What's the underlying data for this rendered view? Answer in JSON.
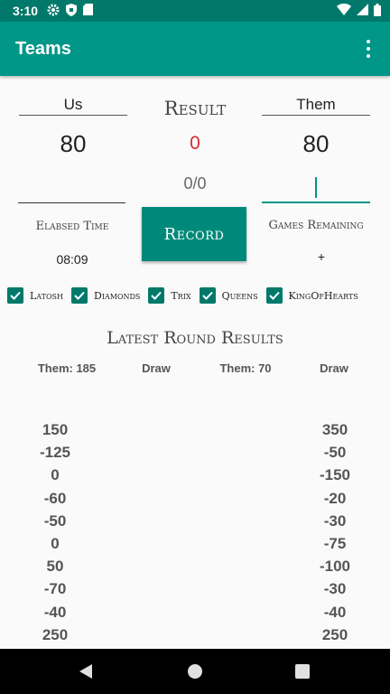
{
  "status_bar": {
    "time": "3:10"
  },
  "app_bar": {
    "title": "Teams"
  },
  "teams": {
    "us": {
      "label": "Us",
      "score": "80"
    },
    "them": {
      "label": "Them",
      "score": "80"
    }
  },
  "result": {
    "title": "Result",
    "value": "0",
    "ratio": "0/0"
  },
  "elapsed": {
    "label": "Elabsed Time",
    "value": "08:09"
  },
  "games_remaining": {
    "label": "Games Remaining",
    "value": "+"
  },
  "record_button": {
    "label": "Record"
  },
  "games": [
    {
      "label": "Latosh",
      "checked": true
    },
    {
      "label": "Diamonds",
      "checked": true
    },
    {
      "label": "Trix",
      "checked": true
    },
    {
      "label": "Queens",
      "checked": true
    },
    {
      "label": "KingOfHearts",
      "checked": true
    }
  ],
  "latest": {
    "title": "Latest Round Results",
    "headers": [
      "Them: 185",
      "Draw",
      "Them: 70",
      "Draw"
    ],
    "us_values": [
      "150",
      "-125",
      "0",
      "-60",
      "-50",
      "0",
      "50",
      "-70",
      "-40",
      "250"
    ],
    "them_values": [
      "350",
      "-50",
      "-150",
      "-20",
      "-30",
      "-75",
      "-100",
      "-30",
      "-40",
      "250"
    ]
  },
  "colors": {
    "status_bar": "#00796b",
    "app_bar": "#009688",
    "accent": "#00897b",
    "result_red": "#d32f2f"
  }
}
